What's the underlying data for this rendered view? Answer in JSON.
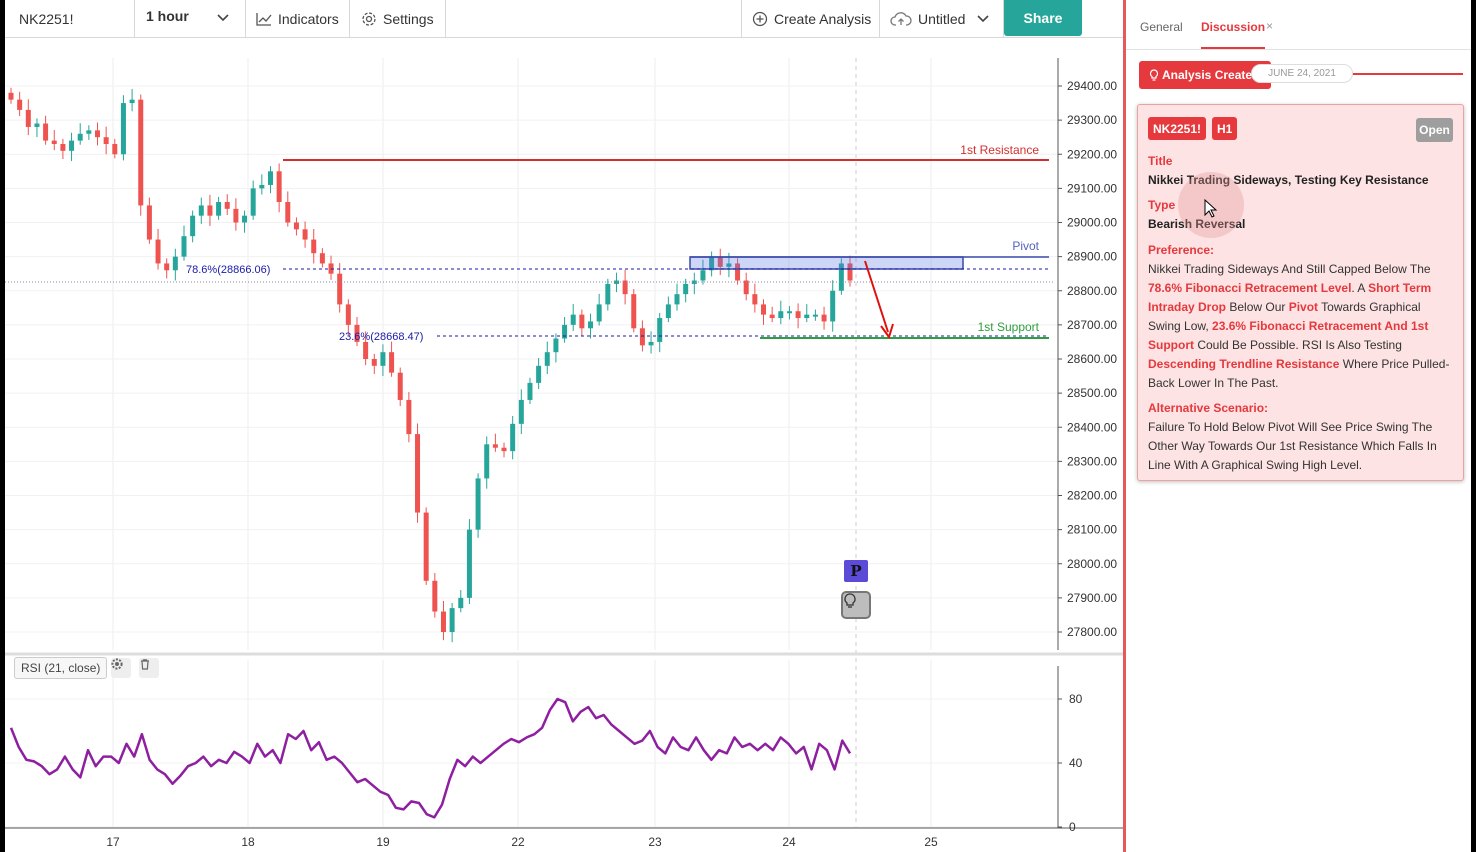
{
  "toolbar": {
    "symbol": "NK2251!",
    "interval": "1 hour",
    "indicators_label": "Indicators",
    "settings_label": "Settings",
    "create_analysis_label": "Create Analysis",
    "untitled_label": "Untitled",
    "share_label": "Share"
  },
  "chart": {
    "rsi_legend": "RSI (21, close)",
    "resistance_label": "1st Resistance",
    "pivot_label": "Pivot",
    "support_label": "1st Support",
    "fib_786_label": "78.6%(28866.06)",
    "fib_236_label": "23.6%(28668.47)",
    "p_badge": "P"
  },
  "chart_data": [
    {
      "type": "candlestick",
      "title": "NK2251!",
      "interval": "1 hour",
      "x_tick_labels": [
        "17",
        "18",
        "19",
        "22",
        "23",
        "24",
        "25"
      ],
      "y_tick_labels": [
        "29400.00",
        "29300.00",
        "29200.00",
        "29100.00",
        "29000.00",
        "28900.00",
        "28800.00",
        "28700.00",
        "28600.00",
        "28500.00",
        "28400.00",
        "28300.00",
        "28200.00",
        "28100.00",
        "28000.00",
        "27900.00",
        "27800.00"
      ],
      "ylim": [
        27750,
        29480
      ],
      "close_trace": [
        29360,
        29330,
        29280,
        29290,
        29240,
        29230,
        29210,
        29240,
        29260,
        29270,
        29250,
        29230,
        29200,
        29350,
        29360,
        29050,
        28950,
        28880,
        28860,
        28900,
        28960,
        29020,
        29050,
        29020,
        29060,
        29040,
        29000,
        29020,
        29100,
        29110,
        29150,
        29060,
        29000,
        28980,
        28950,
        28910,
        28880,
        28850,
        28760,
        28700,
        28650,
        28600,
        28580,
        28620,
        28560,
        28480,
        28380,
        28150,
        27950,
        27860,
        27800,
        27870,
        27900,
        28100,
        28250,
        28350,
        28340,
        28330,
        28410,
        28480,
        28530,
        28580,
        28620,
        28660,
        28700,
        28730,
        28690,
        28710,
        28760,
        28820,
        28830,
        28790,
        28690,
        28640,
        28650,
        28720,
        28760,
        28790,
        28820,
        28830,
        28860,
        28900,
        28870,
        28880,
        28830,
        28790,
        28760,
        28730,
        28720,
        28740,
        28740,
        28720,
        28730,
        28730,
        28710,
        28800,
        28880,
        28830
      ],
      "lines": [
        {
          "name": "1st Resistance",
          "value": 29185
        },
        {
          "name": "Pivot",
          "value": 28895
        },
        {
          "name": "78.6%(28866.06)",
          "value": 28866.06
        },
        {
          "name": "23.6%(28668.47)",
          "value": 28668.47
        },
        {
          "name": "1st Support",
          "value": 28665
        }
      ],
      "pivot_zone": [
        28866,
        28900
      ],
      "projection_arrow": {
        "from": 28900,
        "to": 28665
      }
    },
    {
      "type": "line",
      "title": "RSI (21, close)",
      "y_tick_labels": [
        "80",
        "40",
        "0"
      ],
      "ylim": [
        0,
        100
      ],
      "values": [
        62,
        50,
        42,
        41,
        38,
        33,
        36,
        44,
        36,
        31,
        48,
        38,
        44,
        44,
        40,
        52,
        44,
        58,
        42,
        36,
        33,
        27,
        32,
        38,
        40,
        44,
        38,
        42,
        40,
        47,
        44,
        40,
        52,
        44,
        48,
        40,
        58,
        55,
        60,
        48,
        53,
        42,
        44,
        40,
        34,
        28,
        30,
        26,
        22,
        20,
        12,
        11,
        16,
        15,
        8,
        6,
        14,
        30,
        42,
        38,
        44,
        40,
        44,
        48,
        52,
        55,
        53,
        56,
        58,
        62,
        73,
        80,
        78,
        66,
        72,
        75,
        68,
        70,
        64,
        60,
        56,
        52,
        54,
        60,
        50,
        46,
        56,
        50,
        48,
        56,
        48,
        42,
        48,
        46,
        56,
        50,
        52,
        48,
        52,
        48,
        56,
        52,
        46,
        50,
        36,
        52,
        48,
        36,
        54,
        46
      ],
      "grid": true
    }
  ],
  "panel": {
    "tab_general": "General",
    "tab_discussion": "Discussion",
    "tab_close": "×",
    "created_badge": "Analysis Created",
    "created_date": "JUNE 24, 2021",
    "card": {
      "symbol_badge": "NK2251!",
      "timeframe_badge": "H1",
      "status_badge": "Open",
      "title_label": "Title",
      "title_value": "Nikkei Trading Sideways, Testing Key Resistance",
      "type_label": "Type",
      "type_value": "Bearish Reversal",
      "preference_label": "Preference:",
      "pref_1": "Nikkei Trading Sideways And Still Capped Below The ",
      "pref_2": "78.6% Fibonacci Retracement Level",
      "pref_3": ". A ",
      "pref_4": "Short Term Intraday Drop",
      "pref_5": " Below Our ",
      "pref_6": "Pivot",
      "pref_7": " Towards Graphical Swing Low, ",
      "pref_8": "23.6% Fibonacci Retracement And 1st Support",
      "pref_9": " Could Be Possible. RSI Is Also Testing ",
      "pref_10": "Descending Trendline Resistance",
      "pref_11": " Where Price Pulled-Back Lower In The Past.",
      "alt_label": "Alternative Scenario:",
      "alt_text": "Failure To Hold Below Pivot Will See Price Swing The Other Way Towards Our 1st Resistance Which Falls In Line With A Graphical Swing High Level."
    }
  },
  "colors": {
    "accent": "#e5393d",
    "share": "#26a69a",
    "bull_candle": "#26a69a",
    "bear_candle": "#ef5350",
    "rsi_line": "#8e1fa0",
    "resistance": "#d32f2f",
    "pivot": "#3949ab",
    "support": "#2e9e3e",
    "fib": "#1a1aaa"
  }
}
